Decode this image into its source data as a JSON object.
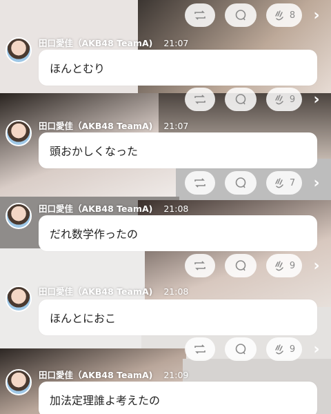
{
  "author": "田口愛佳（AKB48 TeamA)",
  "reaction_icons": {
    "repost": "repost-icon",
    "comment": "comment-bubble-icon",
    "clap": "clap-icon",
    "next": "chevron-right-icon"
  },
  "top_action_bar": {
    "clap_count": "8"
  },
  "posts": [
    {
      "time": "21:07",
      "text": "ほんとむり",
      "clap_count": "9"
    },
    {
      "time": "21:07",
      "text": "頭おかしくなった",
      "clap_count": "7"
    },
    {
      "time": "21:08",
      "text": "だれ数学作ったの",
      "clap_count": "9"
    },
    {
      "time": "21:08",
      "text": "ほんとにおこ",
      "clap_count": "9"
    },
    {
      "time": "21:09",
      "text": "加法定理誰よ考えたの"
    }
  ]
}
